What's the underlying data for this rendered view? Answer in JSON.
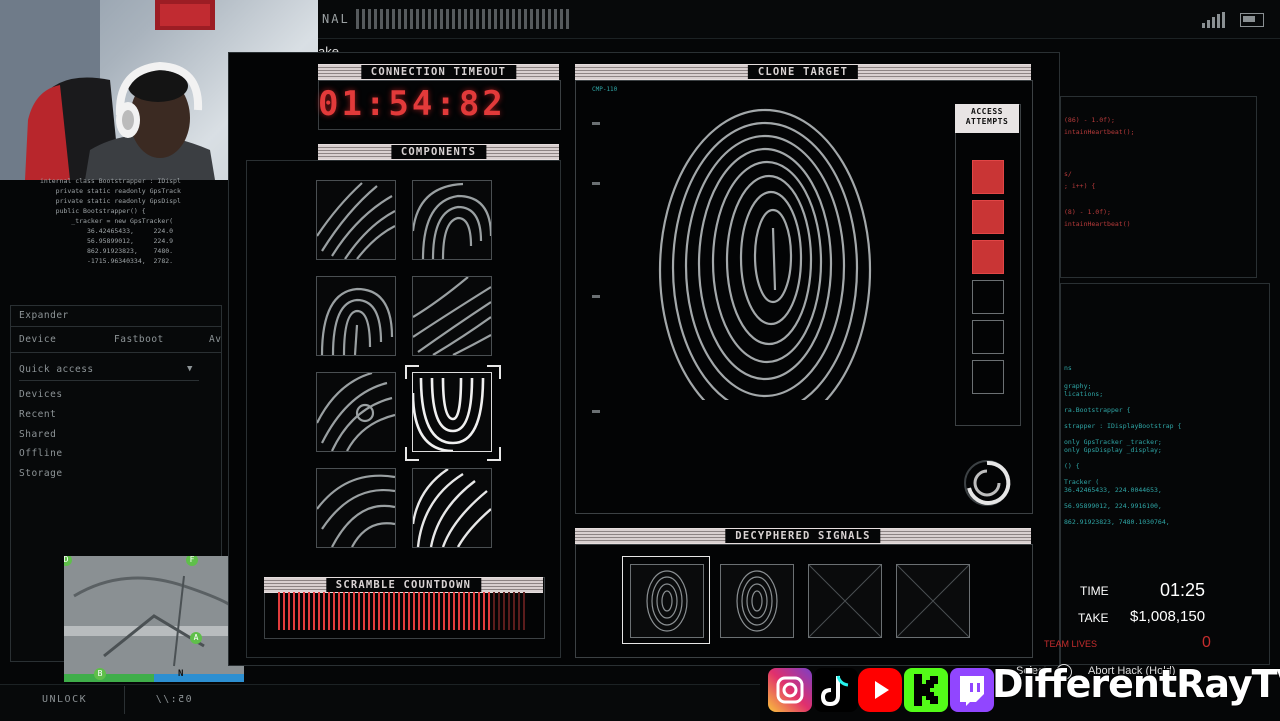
{
  "topbar": {
    "title": "NAL",
    "partial_text": "ake"
  },
  "left_code": {
    "lines": [
      "internal class Bootstrapper : IDispl",
      "",
      "    private static readonly GpsTrack",
      "    private static readonly GpsDispl",
      "",
      "    public Bootstrapper() {",
      "",
      "        _tracker = new GpsTracker(",
      "            36.42465433,     224.0",
      "            56.95899012,     224.9",
      "            862.91923823,    7480.",
      "            -1715.96340334,  2782.",
      "        );"
    ]
  },
  "left_nav": {
    "expander": "Expander",
    "device_label": "Device",
    "device_value": "Fastboot",
    "device_extra": "Av",
    "quick_access": "Quick access",
    "items": [
      "Devices",
      "Recent",
      "Shared",
      "Offline",
      "Storage"
    ]
  },
  "minimap": {
    "markers": [
      {
        "label": "D",
        "color": "#5fbf4a"
      },
      {
        "label": "F",
        "color": "#5fbf4a"
      },
      {
        "label": "A",
        "color": "#5fbf4a"
      },
      {
        "label": "B",
        "color": "#5fbf4a"
      },
      {
        "label": "N",
        "color": "#111111"
      }
    ]
  },
  "bottombar": {
    "unlock": "UNLOCK",
    "code": "05://"
  },
  "hack": {
    "timeout_title": "CONNECTION TIMEOUT",
    "timeout_value": "01:54:82",
    "components_title": "COMPONENTS",
    "clone_title": "CLONE TARGET",
    "clone_tag": "CMP-110",
    "access_title": "ACCESS ATTEMPTS",
    "attempts_used": 3,
    "attempts_total": 6,
    "scramble_title": "SCRAMBLE COUNTDOWN",
    "scramble_fill": 0.86,
    "signals_title": "DECYPHERED SIGNALS"
  },
  "stats": {
    "time_label": "TIME",
    "time_value": "01:25",
    "take_label": "TAKE",
    "take_value": "$1,008,150",
    "team_lives_label": "TEAM LIVES",
    "team_lives_value": "0"
  },
  "prompts": {
    "select": "Select",
    "abort": "Abort Hack (Hold)"
  },
  "right_code": {
    "lines_top": [
      "(86) - 1.0f);",
      "intainHeartbeat();",
      "",
      "",
      "s/",
      "; i++) {",
      "",
      "(8) - 1.0f);",
      "intainHeartbeat()"
    ],
    "lines_bottom": [
      "ns",
      "graphy;",
      "lications;",
      "",
      "ra.Bootstrapper {",
      "",
      "strapper : IDisplayBootstrap {",
      "",
      "only GpsTracker _tracker;",
      "only GpsDisplay _display;",
      "",
      "() {",
      "",
      "Tracker (",
      "    36.42465433,    224.0044653,",
      "    56.95899012,    224.9916100,",
      "    862.91923823,   7480.1030764,"
    ]
  },
  "banner": {
    "name": "DifferentRayTV"
  },
  "colors": {
    "accent_red": "#e23a3a",
    "code_teal": "#2fa6a6",
    "panel_bg": "#030405"
  }
}
